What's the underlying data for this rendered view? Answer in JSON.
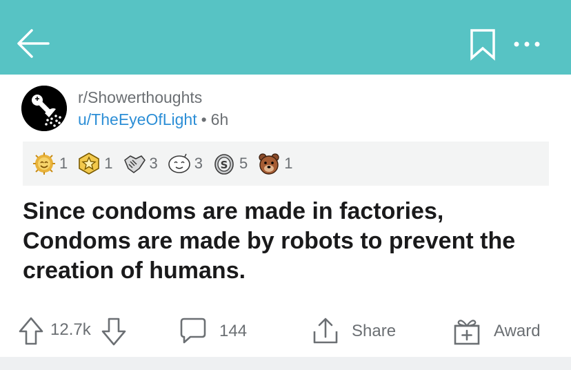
{
  "header": {
    "background": "#57c3c4",
    "icons": [
      "back-arrow-icon",
      "bookmark-icon",
      "more-options-icon"
    ]
  },
  "post": {
    "subreddit": "r/Showerthoughts",
    "author": "u/TheEyeOfLight",
    "separator": "•",
    "age": "6h",
    "title": "Since condoms are made in factories, Condoms are made by robots to prevent the creation of humans."
  },
  "awards": [
    {
      "icon": "gold-sun-award-icon",
      "count": "1"
    },
    {
      "icon": "star-award-icon",
      "count": "1"
    },
    {
      "icon": "handshake-award-icon",
      "count": "3"
    },
    {
      "icon": "face-award-icon",
      "count": "3"
    },
    {
      "icon": "silver-coin-award-icon",
      "count": "5"
    },
    {
      "icon": "bear-award-icon",
      "count": "1"
    }
  ],
  "actions": {
    "score": "12.7k",
    "comments": "144",
    "share_label": "Share",
    "award_label": "Award"
  },
  "colors": {
    "accent": "#57c3c4",
    "link": "#2c8ed6",
    "muted": "#6b6f73",
    "award_bg": "#f3f4f4"
  }
}
